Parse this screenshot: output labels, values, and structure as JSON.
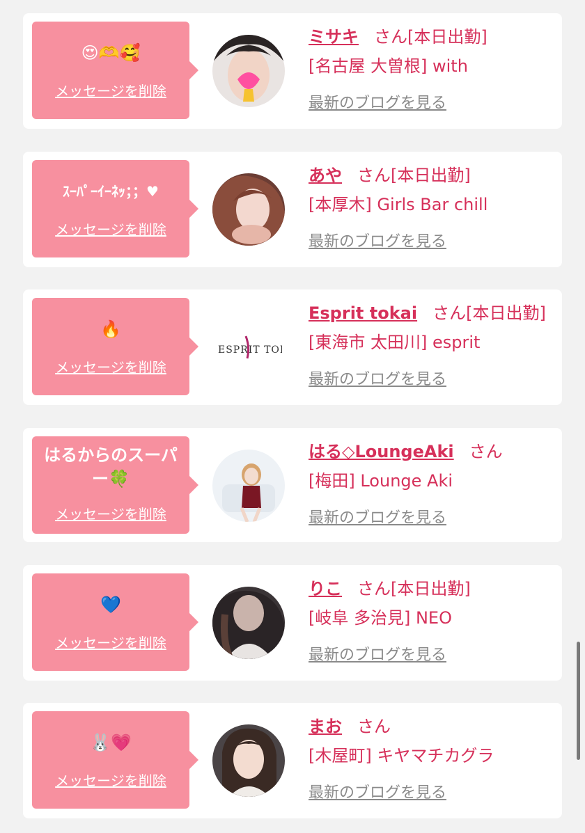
{
  "cards": [
    {
      "message": "😍🫶🥰",
      "delete_label": "メッセージを削除",
      "name": "ミサキ",
      "honorific": "さん",
      "status": "[本日出勤]",
      "shop": "[名古屋 大曽根] with",
      "blog_link": "最新のブログを見る"
    },
    {
      "message": "ｽｰﾊﾟｰｲｰﾈｯ；；♥",
      "delete_label": "メッセージを削除",
      "name": "あや",
      "honorific": "さん",
      "status": "[本日出勤]",
      "shop": "[本厚木] Girls Bar chill",
      "blog_link": "最新のブログを見る"
    },
    {
      "message": "🔥",
      "delete_label": "メッセージを削除",
      "name": "Esprit tokai",
      "honorific": "さん",
      "status": "[本日出勤]",
      "shop": "[東海市 太田川] esprit",
      "blog_link": "最新のブログを見る",
      "logo_text": "ESPRIT TOKAI"
    },
    {
      "message": "はるからのスーパー🍀",
      "delete_label": "メッセージを削除",
      "name": "はる◇LoungeAki",
      "honorific": "さん",
      "status": "",
      "shop": "[梅田] Lounge Aki",
      "blog_link": "最新のブログを見る"
    },
    {
      "message": "💙",
      "delete_label": "メッセージを削除",
      "name": "りこ",
      "honorific": "さん",
      "status": "[本日出勤]",
      "shop": "[岐阜 多治見] NEO",
      "blog_link": "最新のブログを見る"
    },
    {
      "message": "🐰💗",
      "delete_label": "メッセージを削除",
      "name": "まお",
      "honorific": "さん",
      "status": "",
      "shop": "[木屋町] キヤマチカグラ",
      "blog_link": "最新のブログを見る"
    }
  ],
  "colors": {
    "accent": "#d6305a",
    "bubble": "#f7909f",
    "link_gray": "#8a8a8a",
    "background": "#f2f2f2"
  }
}
